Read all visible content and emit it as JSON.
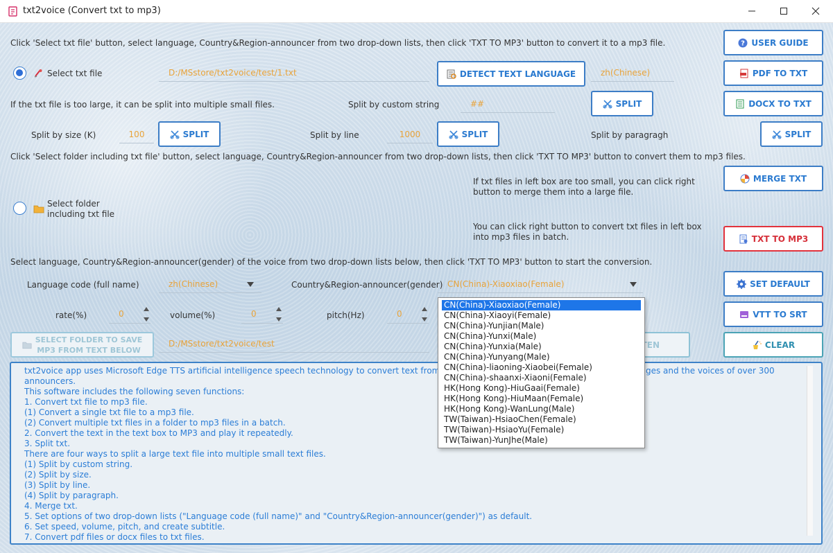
{
  "window": {
    "title": "txt2voice (Convert txt to mp3)"
  },
  "instructions": {
    "line1": "Click 'Select txt file' button, select language, Country&Region-announcer from two drop-down lists, then click 'TXT TO MP3' button to convert it to a mp3 file.",
    "split_hint": "If the txt file is too large, it can be split into multiple small files.",
    "line2": "Click 'Select folder including txt file' button, select language, Country&Region-announcer from two drop-down lists, then click 'TXT TO MP3' button to convert them to mp3 files.",
    "merge_hint_1": "If txt files in left box are too small, you can click right",
    "merge_hint_2": "button to merge them into a large file.",
    "convert_hint_1": "You can click right button to convert txt files in left box",
    "convert_hint_2": "into mp3 files in batch.",
    "line3": "Select language, Country&Region-announcer(gender) of the voice from two drop-down lists below, then click 'TXT TO MP3' button to start the conversion."
  },
  "file_mode": {
    "label": "Select txt file",
    "selected": true,
    "path": "D:/MSstore/txt2voice/test/1.txt"
  },
  "folder_mode": {
    "label_1": "Select folder",
    "label_2": "including txt file",
    "selected": false
  },
  "detect": {
    "button": "DETECT TEXT LANGUAGE",
    "result": "zh(Chinese)"
  },
  "split": {
    "custom_label": "Split by custom string",
    "custom_value": "##",
    "size_label": "Split by size (K)",
    "size_value": "100",
    "line_label": "Split by line",
    "line_value": "1000",
    "paragraph_label": "Split by paragragh",
    "button": "SPLIT"
  },
  "side_buttons": {
    "user_guide": "USER GUIDE",
    "pdf_to_txt": "PDF TO TXT",
    "docx_to_txt": "DOCX TO TXT",
    "merge_txt": "MERGE TXT",
    "txt_to_mp3": "TXT TO MP3",
    "set_default": "SET DEFAULT",
    "vtt_to_srt": "VTT TO SRT",
    "clear": "CLEAR"
  },
  "voice": {
    "language_label": "Language code (full name)",
    "language_value": "zh(Chinese)",
    "announcer_label": "Country&Region-announcer(gender)",
    "announcer_value": "CN(China)-Xiaoxiao(Female)",
    "rate_label": "rate(%)",
    "rate_value": "0",
    "volume_label": "volume(%)",
    "volume_value": "0",
    "pitch_label": "pitch(Hz)",
    "pitch_value": "0"
  },
  "save": {
    "button_1": "SELECT FOLDER TO SAVE",
    "button_2": "MP3 FROM TEXT BELOW",
    "path": "D:/MSstore/txt2voice/test",
    "listen_partial": "TEN"
  },
  "announcer_options": [
    "CN(China)-Xiaoxiao(Female)",
    "CN(China)-Xiaoyi(Female)",
    "CN(China)-Yunjian(Male)",
    "CN(China)-Yunxi(Male)",
    "CN(China)-Yunxia(Male)",
    "CN(China)-Yunyang(Male)",
    "CN(China)-liaoning-Xiaobei(Female)",
    "CN(China)-shaanxi-Xiaoni(Female)",
    "HK(Hong Kong)-HiuGaai(Female)",
    "HK(Hong Kong)-HiuMaan(Female)",
    "HK(Hong Kong)-WanLung(Male)",
    "TW(Taiwan)-HsiaoChen(Female)",
    "TW(Taiwan)-HsiaoYu(Female)",
    "TW(Taiwan)-YunJhe(Male)"
  ],
  "text_lines": [
    "txt2voice app uses Microsoft Edge TTS artificial intelligence speech technology to convert text from multip",
    "announcers.",
    "This software includes the following seven functions:",
    "1. Convert txt file to mp3 file.",
    "(1) Convert a single txt file to a mp3 file.",
    "(2) Convert multiple txt files in a folder to mp3 files in a batch.",
    "2. Convert the text in the text box to MP3 and play it repeatedly.",
    "3. Split txt.",
    "There are four ways to split a large text file into multiple small text files.",
    "(1) Split by custom string.",
    "(2) Split by size.",
    "(3) Split by line.",
    "(4) Split by paragraph.",
    "4. Merge txt.",
    "5. Set options of two drop-down lists (\"Language code (full name)\" and \"Country&Region-announcer(gender)\") as default.",
    "6. Set speed, volume, pitch, and create subtitle.",
    "7. Convert pdf files or docx files to txt files."
  ],
  "text_line1_tail": "uages and the voices of over 300"
}
